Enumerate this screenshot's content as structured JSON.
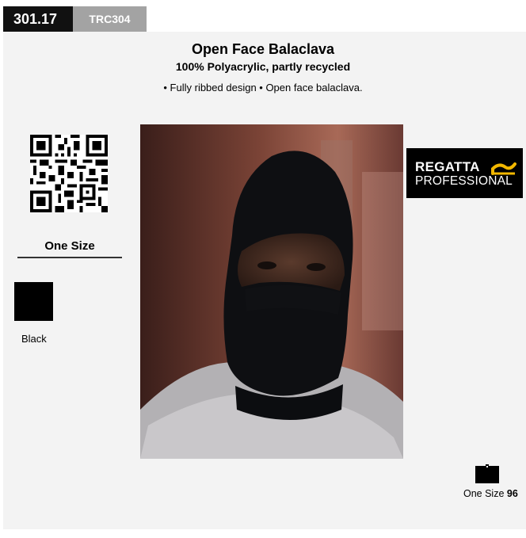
{
  "product": {
    "code": "301.17",
    "reference": "TRC304",
    "title": "Open Face Balaclava",
    "material": "100% Polyacrylic, partly recycled",
    "features": "• Fully ribbed design • Open face balaclava."
  },
  "sizing": {
    "label": "One Size"
  },
  "colours": [
    {
      "name": "Black",
      "hex": "#000000"
    }
  ],
  "brand": {
    "line1": "REGATTA",
    "line2": "PROFESSIONAL",
    "accent": "#f2b700"
  },
  "packing": {
    "size": "One Size",
    "quantity": "96"
  },
  "icons": {
    "qr": "qr-code-icon",
    "pack": "box-icon"
  }
}
